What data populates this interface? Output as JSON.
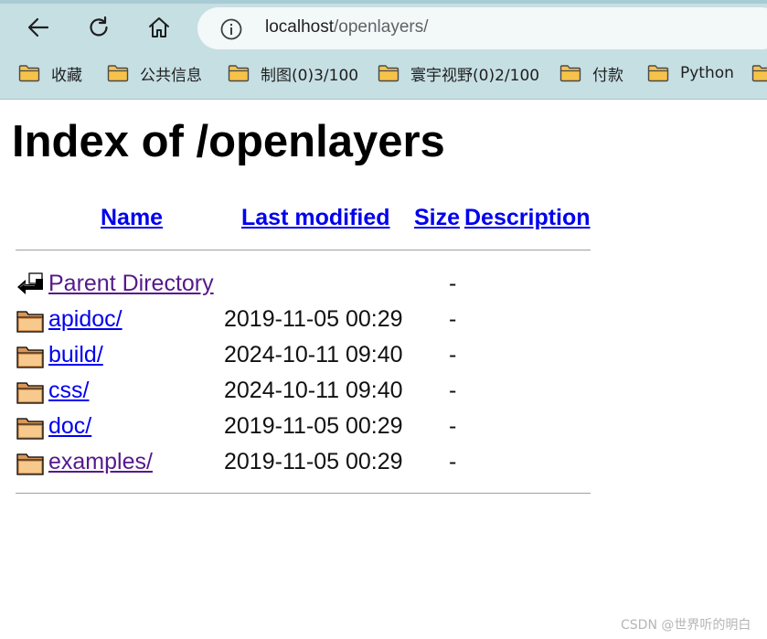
{
  "browser": {
    "url_host": "localhost",
    "url_path": "/openlayers/",
    "bookmarks": [
      {
        "label": "收藏",
        "icon": "folder-icon"
      },
      {
        "label": "公共信息",
        "icon": "folder-icon"
      },
      {
        "label": "制图(0)3/100",
        "icon": "folder-icon"
      },
      {
        "label": "寰宇视野(0)2/100",
        "icon": "folder-icon"
      },
      {
        "label": "付款",
        "icon": "folder-icon"
      },
      {
        "label": "Python",
        "icon": "folder-icon"
      }
    ],
    "colors": {
      "chrome": "#c6dfe3",
      "address_bar": "#f3f8f9",
      "folder": "#f6c24a"
    }
  },
  "page": {
    "title": "Index of /openlayers",
    "columns": {
      "name": "Name",
      "last_modified": "Last modified",
      "size": "Size",
      "description": "Description"
    },
    "rows": [
      {
        "icon": "back-arrow-icon",
        "name": "Parent Directory",
        "modified": "",
        "size": "-",
        "visited": true
      },
      {
        "icon": "folder-icon",
        "name": "apidoc/",
        "modified": "2019-11-05 00:29",
        "size": "-",
        "visited": false
      },
      {
        "icon": "folder-icon",
        "name": "build/",
        "modified": "2024-10-11 09:40",
        "size": "-",
        "visited": false
      },
      {
        "icon": "folder-icon",
        "name": "css/",
        "modified": "2024-10-11 09:40",
        "size": "-",
        "visited": false
      },
      {
        "icon": "folder-icon",
        "name": "doc/",
        "modified": "2019-11-05 00:29",
        "size": "-",
        "visited": false
      },
      {
        "icon": "folder-icon",
        "name": "examples/",
        "modified": "2019-11-05 00:29",
        "size": "-",
        "visited": true
      }
    ],
    "colors": {
      "link": "#0000ee",
      "visited_link": "#551a8b"
    }
  },
  "watermark": "CSDN @世界听的明白"
}
